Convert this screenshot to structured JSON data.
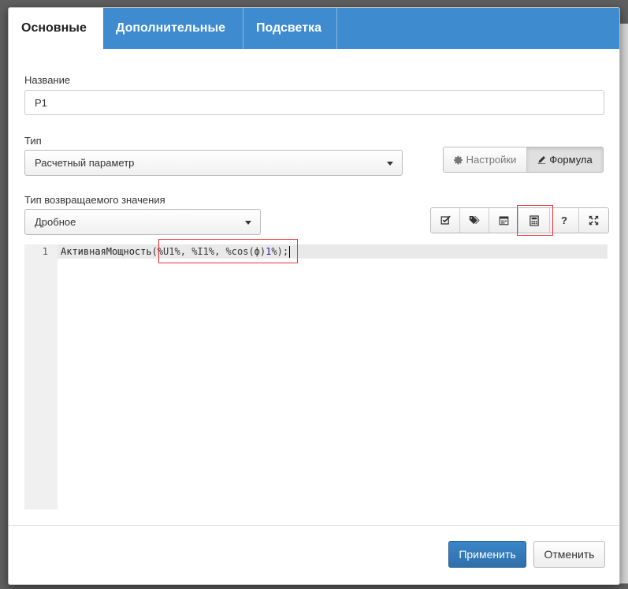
{
  "tabs": [
    {
      "label": "Основные",
      "active": true
    },
    {
      "label": "Дополнительные",
      "active": false
    },
    {
      "label": "Подсветка",
      "active": false
    }
  ],
  "form": {
    "name": {
      "label": "Название",
      "value": "P1"
    },
    "type": {
      "label": "Тип",
      "value": "Расчетный параметр"
    },
    "return_type": {
      "label": "Тип возвращаемого значения",
      "value": "Дробное"
    }
  },
  "mode_buttons": {
    "settings": {
      "label": "Настройки",
      "icon": "gear-icon"
    },
    "formula": {
      "label": "Формула",
      "icon": "pencil-icon",
      "active": true
    }
  },
  "toolbar": {
    "icons": [
      "checkbox-icon",
      "tags-icon",
      "calendar-icon",
      "calculator-icon",
      "question-icon",
      "expand-icon"
    ],
    "help_label": "?"
  },
  "editor": {
    "line_number": "1",
    "tokens": {
      "fn": "АктивнаяМощность",
      "open": "(",
      "v1": "%U1%",
      "sep1": ", ",
      "v2": "%I1%",
      "sep2": ", ",
      "v3a": "%cos(ф)",
      "v3b": "1",
      "v3c": "%",
      "close": ");"
    }
  },
  "footer": {
    "apply_label": "Применить",
    "cancel_label": "Отменить"
  },
  "colors": {
    "tab_bar": "#3e8bd0",
    "primary_button": "#337ab7",
    "highlight": "#e8343a"
  }
}
